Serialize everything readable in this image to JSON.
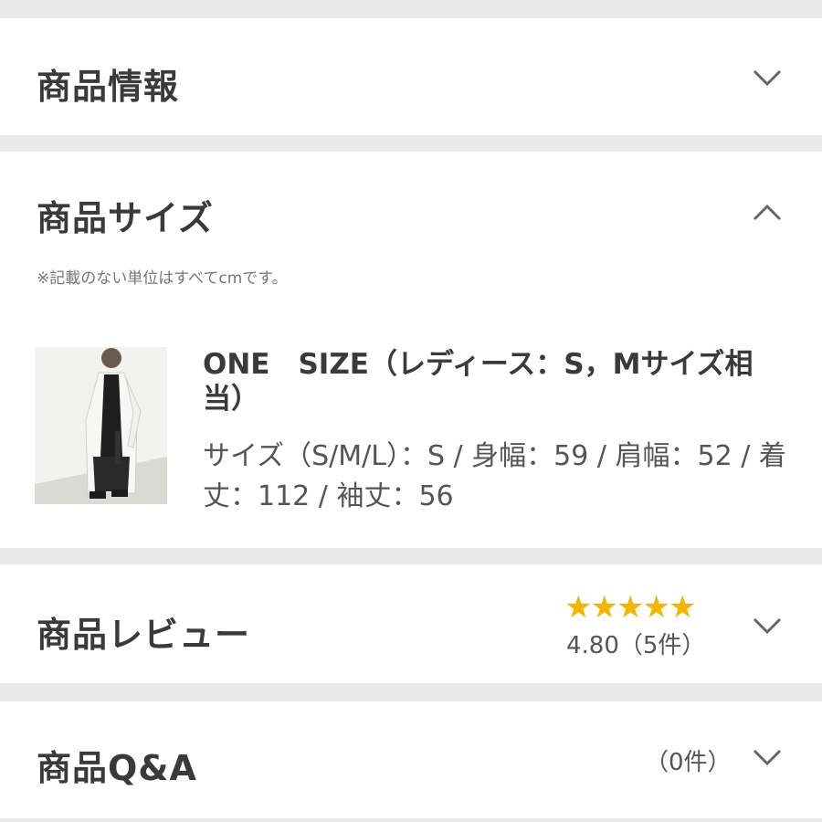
{
  "sections": {
    "info": {
      "title": "商品情報"
    },
    "size": {
      "title": "商品サイズ",
      "note": "※記載のない単位はすべてcmです。",
      "item_name": "ONE　SIZE（レディース：S，Mサイズ相当）",
      "item_detail": "サイズ（S/M/L）：S / 身幅：59 / 肩幅：52 / 着丈：112 / 袖丈：56"
    },
    "review": {
      "title": "商品レビュー",
      "stars": 5,
      "rating_text": "4.80（5件）"
    },
    "qa": {
      "title": "商品Q&A",
      "count_text": "（0件）"
    }
  },
  "icons": {
    "collapsed": "chevron-down-icon",
    "expanded": "chevron-up-icon",
    "rating": "star-icon"
  },
  "colors": {
    "star": "#f5b400",
    "background": "#e9e9e9",
    "card": "#ffffff"
  }
}
